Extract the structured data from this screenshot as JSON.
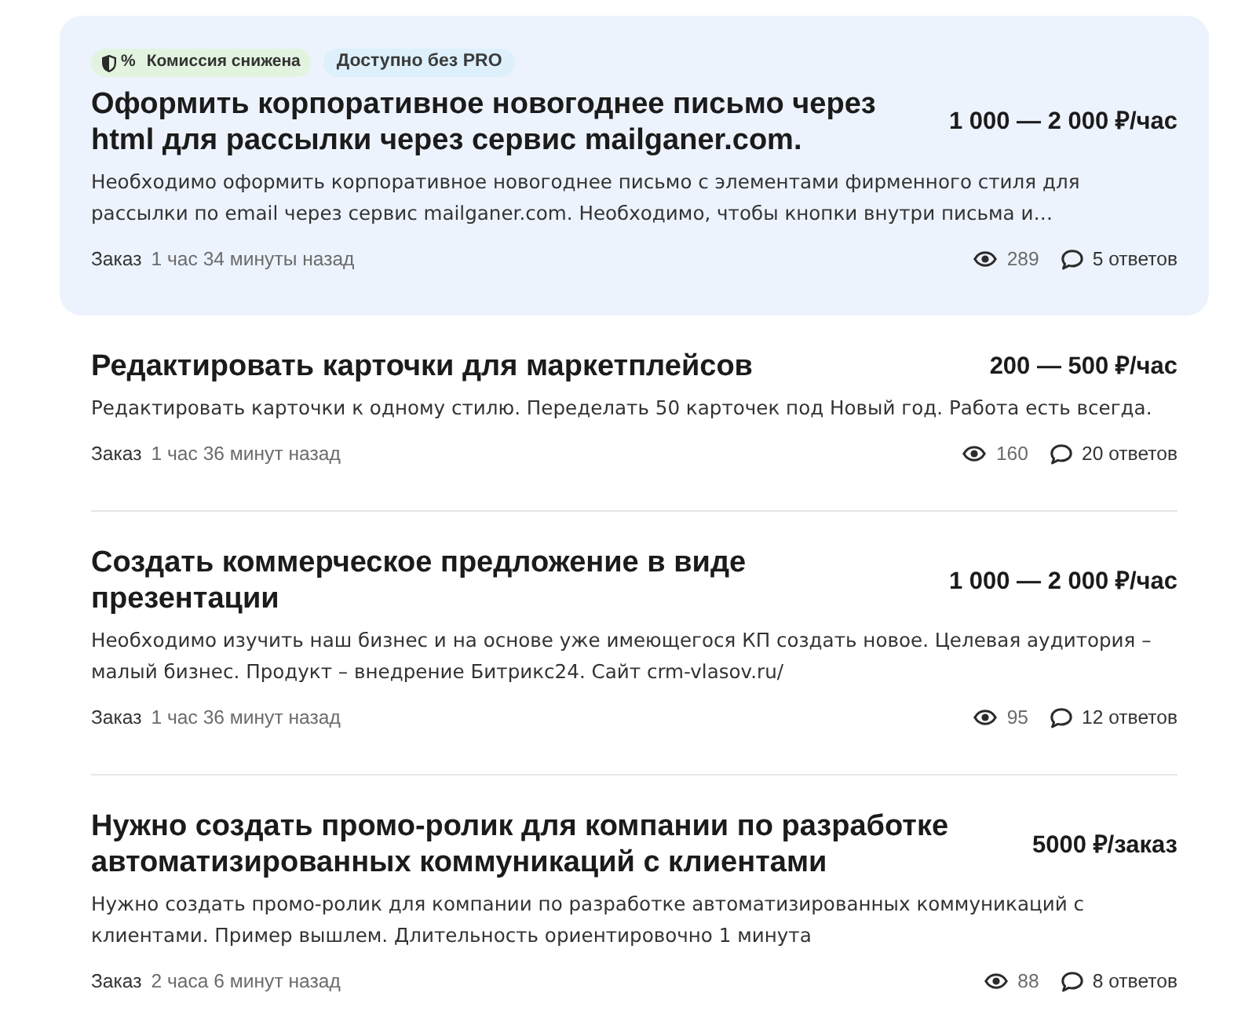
{
  "orders": [
    {
      "highlighted": true,
      "badges": [
        {
          "kind": "commission",
          "symbol": "%",
          "label": "Комиссия снижена"
        },
        {
          "kind": "no_pro",
          "label": "Доступно без PRO"
        }
      ],
      "title": "Оформить корпоративное новогоднее письмо через html для рассылки через сервис mailganer.com.",
      "price": "1 000 — 2 000 ₽/час",
      "description": "Необходимо оформить корпоративное новогоднее письмо с элементами фирменного стиля для рассылки по email через сервис mailganer.com. Необходимо, чтобы кнопки внутри письма и…",
      "type": "Заказ",
      "posted": "1 час 34 минуты назад",
      "views": "289",
      "replies": "5 ответов"
    },
    {
      "highlighted": false,
      "title": "Редактировать карточки для маркетплейсов",
      "price": "200 — 500 ₽/час",
      "description": "Редактировать карточки к одному стилю. Переделать 50 карточек под Новый год. Работа есть всегда.",
      "type": "Заказ",
      "posted": "1 час 36 минут назад",
      "views": "160",
      "replies": "20 ответов"
    },
    {
      "highlighted": false,
      "title": "Создать коммерческое предложение в виде презентации",
      "price": "1 000 — 2 000 ₽/час",
      "description": "Необходимо изучить наш бизнес и на основе уже имеющегося КП создать новое. Целевая аудитория – малый бизнес. Продукт – внедрение Битрикс24. Сайт crm-vlasov.ru/",
      "type": "Заказ",
      "posted": "1 час 36 минут назад",
      "views": "95",
      "replies": "12 ответов"
    },
    {
      "highlighted": false,
      "title": "Нужно создать промо-ролик для компании по разработке автоматизированных коммуникаций с клиентами",
      "price": "5000 ₽/заказ",
      "description": "Нужно создать промо-ролик для компании по разработке автоматизированных коммуникаций с клиентами. Пример вышлем. Длительность ориентировочно 1 минута",
      "type": "Заказ",
      "posted": "2 часа 6 минут назад",
      "views": "88",
      "replies": "8 ответов"
    }
  ]
}
